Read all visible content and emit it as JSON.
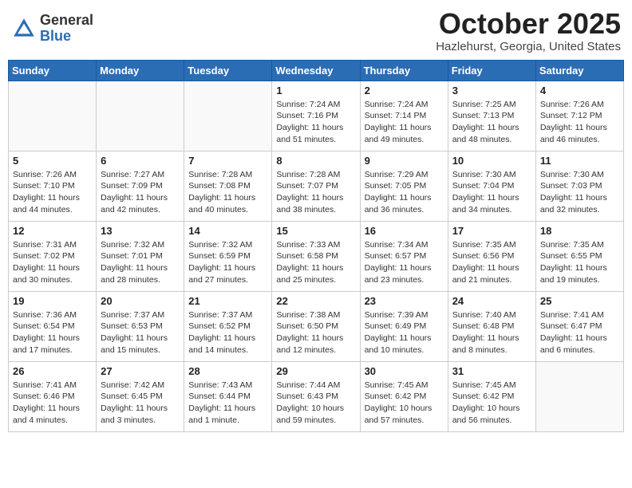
{
  "header": {
    "logo_general": "General",
    "logo_blue": "Blue",
    "month": "October 2025",
    "location": "Hazlehurst, Georgia, United States"
  },
  "weekdays": [
    "Sunday",
    "Monday",
    "Tuesday",
    "Wednesday",
    "Thursday",
    "Friday",
    "Saturday"
  ],
  "weeks": [
    [
      {
        "day": "",
        "sunrise": "",
        "sunset": "",
        "daylight": ""
      },
      {
        "day": "",
        "sunrise": "",
        "sunset": "",
        "daylight": ""
      },
      {
        "day": "",
        "sunrise": "",
        "sunset": "",
        "daylight": ""
      },
      {
        "day": "1",
        "sunrise": "Sunrise: 7:24 AM",
        "sunset": "Sunset: 7:16 PM",
        "daylight": "Daylight: 11 hours and 51 minutes."
      },
      {
        "day": "2",
        "sunrise": "Sunrise: 7:24 AM",
        "sunset": "Sunset: 7:14 PM",
        "daylight": "Daylight: 11 hours and 49 minutes."
      },
      {
        "day": "3",
        "sunrise": "Sunrise: 7:25 AM",
        "sunset": "Sunset: 7:13 PM",
        "daylight": "Daylight: 11 hours and 48 minutes."
      },
      {
        "day": "4",
        "sunrise": "Sunrise: 7:26 AM",
        "sunset": "Sunset: 7:12 PM",
        "daylight": "Daylight: 11 hours and 46 minutes."
      }
    ],
    [
      {
        "day": "5",
        "sunrise": "Sunrise: 7:26 AM",
        "sunset": "Sunset: 7:10 PM",
        "daylight": "Daylight: 11 hours and 44 minutes."
      },
      {
        "day": "6",
        "sunrise": "Sunrise: 7:27 AM",
        "sunset": "Sunset: 7:09 PM",
        "daylight": "Daylight: 11 hours and 42 minutes."
      },
      {
        "day": "7",
        "sunrise": "Sunrise: 7:28 AM",
        "sunset": "Sunset: 7:08 PM",
        "daylight": "Daylight: 11 hours and 40 minutes."
      },
      {
        "day": "8",
        "sunrise": "Sunrise: 7:28 AM",
        "sunset": "Sunset: 7:07 PM",
        "daylight": "Daylight: 11 hours and 38 minutes."
      },
      {
        "day": "9",
        "sunrise": "Sunrise: 7:29 AM",
        "sunset": "Sunset: 7:05 PM",
        "daylight": "Daylight: 11 hours and 36 minutes."
      },
      {
        "day": "10",
        "sunrise": "Sunrise: 7:30 AM",
        "sunset": "Sunset: 7:04 PM",
        "daylight": "Daylight: 11 hours and 34 minutes."
      },
      {
        "day": "11",
        "sunrise": "Sunrise: 7:30 AM",
        "sunset": "Sunset: 7:03 PM",
        "daylight": "Daylight: 11 hours and 32 minutes."
      }
    ],
    [
      {
        "day": "12",
        "sunrise": "Sunrise: 7:31 AM",
        "sunset": "Sunset: 7:02 PM",
        "daylight": "Daylight: 11 hours and 30 minutes."
      },
      {
        "day": "13",
        "sunrise": "Sunrise: 7:32 AM",
        "sunset": "Sunset: 7:01 PM",
        "daylight": "Daylight: 11 hours and 28 minutes."
      },
      {
        "day": "14",
        "sunrise": "Sunrise: 7:32 AM",
        "sunset": "Sunset: 6:59 PM",
        "daylight": "Daylight: 11 hours and 27 minutes."
      },
      {
        "day": "15",
        "sunrise": "Sunrise: 7:33 AM",
        "sunset": "Sunset: 6:58 PM",
        "daylight": "Daylight: 11 hours and 25 minutes."
      },
      {
        "day": "16",
        "sunrise": "Sunrise: 7:34 AM",
        "sunset": "Sunset: 6:57 PM",
        "daylight": "Daylight: 11 hours and 23 minutes."
      },
      {
        "day": "17",
        "sunrise": "Sunrise: 7:35 AM",
        "sunset": "Sunset: 6:56 PM",
        "daylight": "Daylight: 11 hours and 21 minutes."
      },
      {
        "day": "18",
        "sunrise": "Sunrise: 7:35 AM",
        "sunset": "Sunset: 6:55 PM",
        "daylight": "Daylight: 11 hours and 19 minutes."
      }
    ],
    [
      {
        "day": "19",
        "sunrise": "Sunrise: 7:36 AM",
        "sunset": "Sunset: 6:54 PM",
        "daylight": "Daylight: 11 hours and 17 minutes."
      },
      {
        "day": "20",
        "sunrise": "Sunrise: 7:37 AM",
        "sunset": "Sunset: 6:53 PM",
        "daylight": "Daylight: 11 hours and 15 minutes."
      },
      {
        "day": "21",
        "sunrise": "Sunrise: 7:37 AM",
        "sunset": "Sunset: 6:52 PM",
        "daylight": "Daylight: 11 hours and 14 minutes."
      },
      {
        "day": "22",
        "sunrise": "Sunrise: 7:38 AM",
        "sunset": "Sunset: 6:50 PM",
        "daylight": "Daylight: 11 hours and 12 minutes."
      },
      {
        "day": "23",
        "sunrise": "Sunrise: 7:39 AM",
        "sunset": "Sunset: 6:49 PM",
        "daylight": "Daylight: 11 hours and 10 minutes."
      },
      {
        "day": "24",
        "sunrise": "Sunrise: 7:40 AM",
        "sunset": "Sunset: 6:48 PM",
        "daylight": "Daylight: 11 hours and 8 minutes."
      },
      {
        "day": "25",
        "sunrise": "Sunrise: 7:41 AM",
        "sunset": "Sunset: 6:47 PM",
        "daylight": "Daylight: 11 hours and 6 minutes."
      }
    ],
    [
      {
        "day": "26",
        "sunrise": "Sunrise: 7:41 AM",
        "sunset": "Sunset: 6:46 PM",
        "daylight": "Daylight: 11 hours and 4 minutes."
      },
      {
        "day": "27",
        "sunrise": "Sunrise: 7:42 AM",
        "sunset": "Sunset: 6:45 PM",
        "daylight": "Daylight: 11 hours and 3 minutes."
      },
      {
        "day": "28",
        "sunrise": "Sunrise: 7:43 AM",
        "sunset": "Sunset: 6:44 PM",
        "daylight": "Daylight: 11 hours and 1 minute."
      },
      {
        "day": "29",
        "sunrise": "Sunrise: 7:44 AM",
        "sunset": "Sunset: 6:43 PM",
        "daylight": "Daylight: 10 hours and 59 minutes."
      },
      {
        "day": "30",
        "sunrise": "Sunrise: 7:45 AM",
        "sunset": "Sunset: 6:42 PM",
        "daylight": "Daylight: 10 hours and 57 minutes."
      },
      {
        "day": "31",
        "sunrise": "Sunrise: 7:45 AM",
        "sunset": "Sunset: 6:42 PM",
        "daylight": "Daylight: 10 hours and 56 minutes."
      },
      {
        "day": "",
        "sunrise": "",
        "sunset": "",
        "daylight": ""
      }
    ]
  ]
}
